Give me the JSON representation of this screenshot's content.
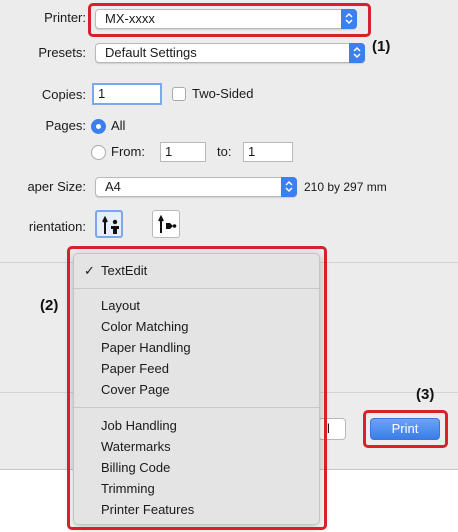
{
  "printer": {
    "label": "Printer:",
    "value": "MX-xxxx"
  },
  "presets": {
    "label": "Presets:",
    "value": "Default Settings"
  },
  "copies": {
    "label": "Copies:",
    "value": "1",
    "two_sided_label": "Two-Sided"
  },
  "pages": {
    "label": "Pages:",
    "all_label": "All",
    "from_label": "From:",
    "from_value": "1",
    "to_label": "to:",
    "to_value": "1"
  },
  "paper_size": {
    "label": "aper Size:",
    "value": "A4",
    "dimensions": "210 by 297 mm"
  },
  "orientation": {
    "label": "rientation:"
  },
  "menu": {
    "checked_item": "TextEdit",
    "group1": [
      "Layout",
      "Color Matching",
      "Paper Handling",
      "Paper Feed",
      "Cover Page"
    ],
    "group2": [
      "Job Handling",
      "Watermarks",
      "Billing Code",
      "Trimming",
      "Printer Features"
    ]
  },
  "buttons": {
    "cancel_fragment": "l",
    "print": "Print"
  },
  "callouts": {
    "c1": "(1)",
    "c2": "(2)",
    "c3": "(3)"
  },
  "colors": {
    "highlight": "#d8202c",
    "accent": "#3b7ff0"
  }
}
